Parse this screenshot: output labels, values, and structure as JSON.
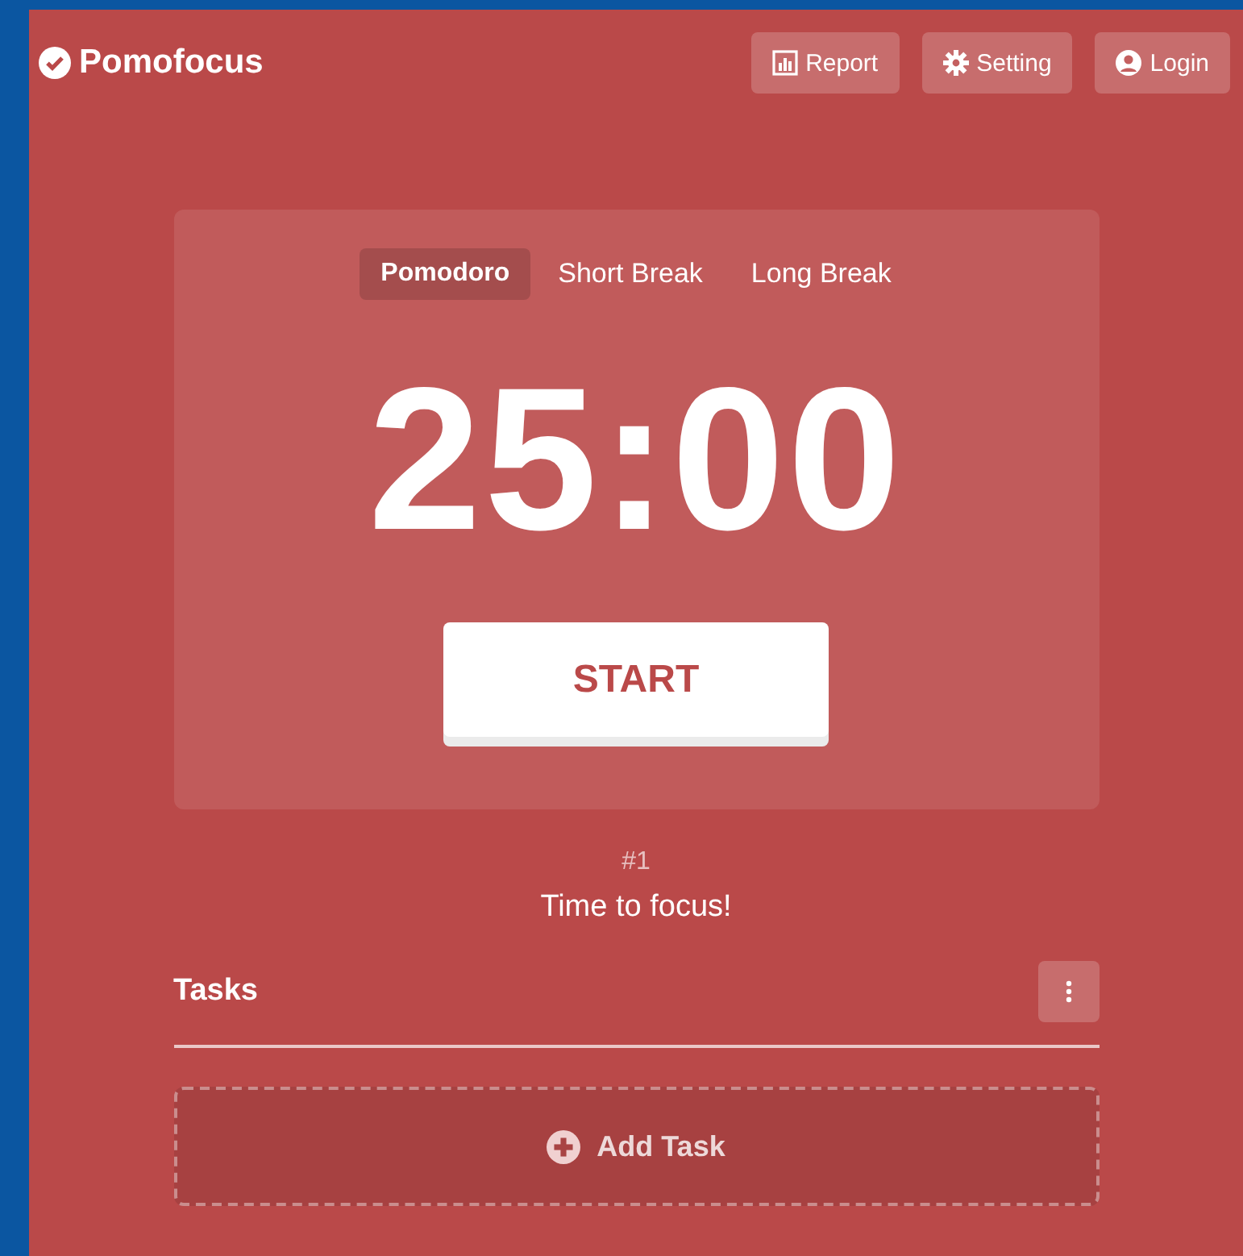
{
  "header": {
    "brand": "Pomofocus",
    "buttons": [
      {
        "kind": "report",
        "label": "Report"
      },
      {
        "kind": "setting",
        "label": "Setting"
      },
      {
        "kind": "login",
        "label": "Login"
      }
    ]
  },
  "timer": {
    "modes": [
      {
        "label": "Pomodoro",
        "selected": true
      },
      {
        "label": "Short Break",
        "selected": false
      },
      {
        "label": "Long Break",
        "selected": false
      }
    ],
    "time": "25:00",
    "action": "START"
  },
  "session": {
    "count": "#1",
    "message": "Time to focus!"
  },
  "tasks": {
    "title": "Tasks",
    "add_label": "Add Task"
  }
}
